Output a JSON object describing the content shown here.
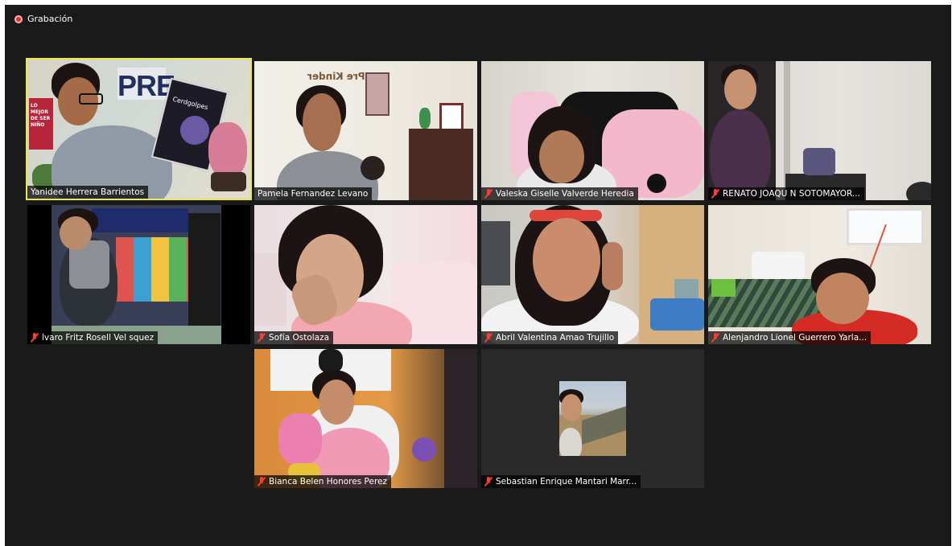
{
  "window": {
    "recording_label": "Grabación",
    "recording_icon": "record-dot-icon",
    "colors": {
      "background": "#1a1a1a",
      "active_speaker": "#e8e84a",
      "muted": "#ff3b30"
    }
  },
  "participants": [
    {
      "name": "Yanidee Herrera Barrientos",
      "muted": false,
      "active": true,
      "sign_text": "PRE",
      "poster_text": "LO MEJOR DE SER NIÑO",
      "book_text": "Cerdgolpes"
    },
    {
      "name": "Pamela Fernandez Levano",
      "muted": false,
      "active": false,
      "wall_text": "Pre Kinder"
    },
    {
      "name": "Valeska Giselle Valverde Heredia",
      "muted": true,
      "active": false
    },
    {
      "name": "RENATO JOAQU N SOTOMAYOR...",
      "muted": true,
      "active": false
    },
    {
      "name": "lvaro Fritz Rosell Vel squez",
      "muted": true,
      "active": false
    },
    {
      "name": "Sofía Ostolaza",
      "muted": true,
      "active": false
    },
    {
      "name": "Abril Valentina Amao Trujillo",
      "muted": true,
      "active": false
    },
    {
      "name": "Alenjandro Lionel Guerrero Yarla...",
      "muted": true,
      "active": false
    },
    {
      "name": "Bianca Belen Honores Perez",
      "muted": true,
      "active": false
    },
    {
      "name": "Sebastian Enrique Mantari Marr...",
      "muted": true,
      "active": false,
      "video_off": true
    }
  ]
}
